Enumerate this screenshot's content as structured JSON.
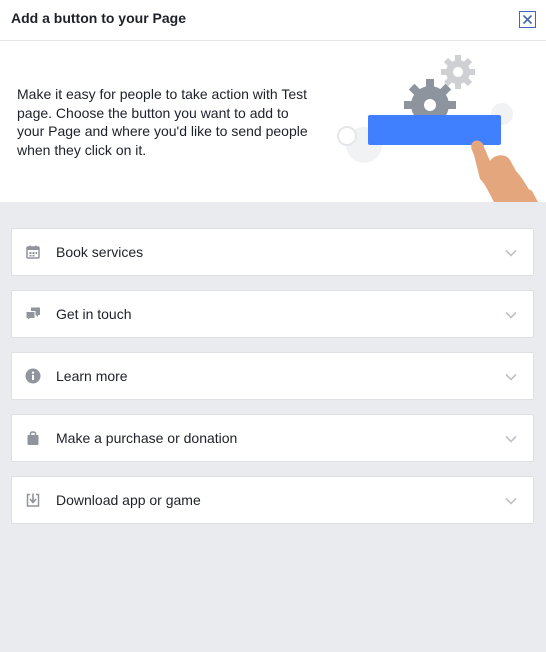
{
  "dialog": {
    "title": "Add a button to your Page",
    "close_icon": "close-x-icon"
  },
  "intro": {
    "text": "Make it easy for people to take action with Test page. Choose the button you want to add to your Page and where you'd like to send people when they click on it."
  },
  "colors": {
    "accent_blue": "#4080ff",
    "page_background": "#e9ebee",
    "icon_gray": "#90949c"
  },
  "options": [
    {
      "label": "Book services",
      "icon": "calendar-icon"
    },
    {
      "label": "Get in touch",
      "icon": "chat-bubbles-icon"
    },
    {
      "label": "Learn more",
      "icon": "info-icon"
    },
    {
      "label": "Make a purchase or donation",
      "icon": "shopping-bag-icon"
    },
    {
      "label": "Download app or game",
      "icon": "download-icon"
    }
  ]
}
